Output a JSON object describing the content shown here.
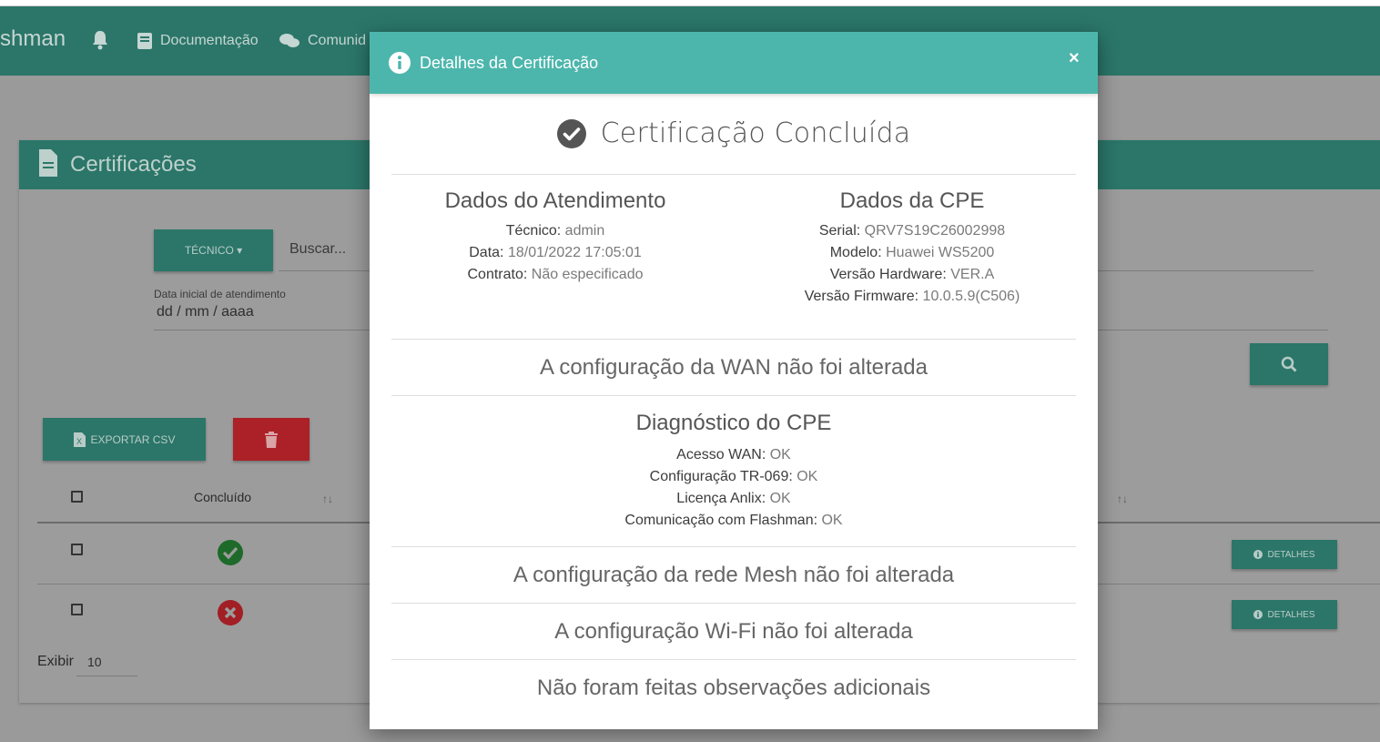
{
  "nav": {
    "brand": "shman",
    "documentacao": "Documentação",
    "comunidade": "Comunid"
  },
  "card": {
    "title": "Certificações",
    "tecnico_button": "TÉCNICO ▾",
    "search_placeholder": "Buscar...",
    "date_label": "Data inicial de atendimento",
    "date_value": "dd / mm / aaaa",
    "export_button": "EXPORTAR CSV",
    "table": {
      "col_concluido": "Concluído",
      "sort_symbol": "↑↓",
      "rows": [
        {
          "status": "success",
          "details_button": "DETALHES"
        },
        {
          "status": "failure",
          "details_button": "DETALHES"
        }
      ]
    },
    "exibir_label": "Exibir",
    "exibir_value": "10"
  },
  "modal": {
    "title": "Detalhes da Certificação",
    "close": "×",
    "heading": "Certificação Concluída",
    "atendimento": {
      "title": "Dados do Atendimento",
      "tecnico_label": "Técnico:",
      "tecnico_value": " admin",
      "data_label": "Data:",
      "data_value": " 18/01/2022 17:05:01",
      "contrato_label": "Contrato:",
      "contrato_value": " Não especificado"
    },
    "cpe": {
      "title": "Dados da CPE",
      "serial_label": "Serial:",
      "serial_value": " QRV7S19C26002998",
      "modelo_label": "Modelo:",
      "modelo_value": " Huawei WS5200",
      "hardware_label": "Versão Hardware:",
      "hardware_value": " VER.A",
      "firmware_label": "Versão Firmware:",
      "firmware_value": " 10.0.5.9(C506)"
    },
    "wan_text": "A configuração da WAN não foi alterada",
    "diagnostico": {
      "title": "Diagnóstico do CPE",
      "items": [
        {
          "label": "Acesso WAN:",
          "value": " OK"
        },
        {
          "label": "Configuração TR-069:",
          "value": " OK"
        },
        {
          "label": "Licença Anlix:",
          "value": " OK"
        },
        {
          "label": "Comunicação com Flashman:",
          "value": " OK"
        }
      ]
    },
    "mesh_text": "A configuração da rede Mesh não foi alterada",
    "wifi_text": "A configuração Wi-Fi não foi alterada",
    "obs_text": "Não foram feitas observações adicionais"
  },
  "colors": {
    "navbar": "#2b7669",
    "modal_header": "#4db6ac",
    "success": "#2e7d32",
    "danger": "#c62828"
  },
  "icons": [
    "bell-icon",
    "book-icon",
    "comments-icon",
    "file-icon",
    "search-icon",
    "file-excel-icon",
    "trash-icon",
    "check-circle-icon",
    "times-circle-icon",
    "info-circle-icon",
    "close-icon"
  ]
}
